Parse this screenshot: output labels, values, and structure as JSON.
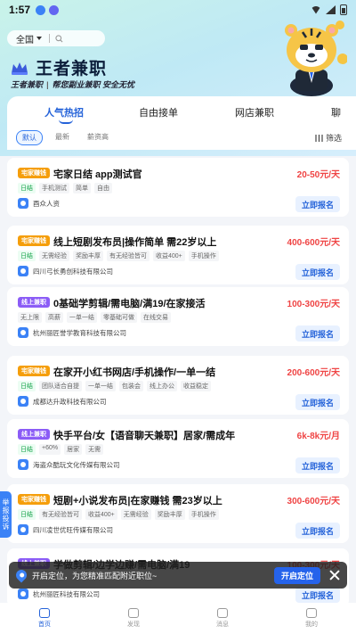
{
  "status_bar": {
    "time": "1:57"
  },
  "search": {
    "city": "全国"
  },
  "brand": {
    "title": "王者兼职",
    "subtitle_left": "王者兼职",
    "subtitle_right": "帮您副业兼职 安全无忧"
  },
  "tabs": [
    {
      "label": "人气热招",
      "active": true
    },
    {
      "label": "自由接单",
      "active": false
    },
    {
      "label": "网店兼职",
      "active": false
    },
    {
      "label": "聊",
      "active": false
    }
  ],
  "subfilters": [
    {
      "label": "默认",
      "active": true
    },
    {
      "label": "最新",
      "active": false
    },
    {
      "label": "薪资高",
      "active": false
    }
  ],
  "filter_label": "筛选",
  "jobs": [
    {
      "badge": "宅家赚钱",
      "badge_color": "orange",
      "title": "宅家日结 app测试官",
      "salary": "20-50元/天",
      "tags": [
        {
          "text": "日结",
          "green": true
        },
        {
          "text": "手机测试",
          "green": false
        },
        {
          "text": "简单",
          "green": false
        },
        {
          "text": "自由",
          "green": false
        }
      ],
      "company": "酉众人资",
      "apply": "立即报名"
    },
    {
      "badge": "宅家赚钱",
      "badge_color": "orange",
      "title": "线上短剧发布员|操作简单 需22岁以上",
      "salary": "400-600元/天",
      "tags": [
        {
          "text": "日结",
          "green": true
        },
        {
          "text": "无需经验",
          "green": false
        },
        {
          "text": "奖励丰厚",
          "green": false
        },
        {
          "text": "有无经验皆可",
          "green": false
        },
        {
          "text": "收益400+",
          "green": false
        },
        {
          "text": "手机操作",
          "green": false
        }
      ],
      "company": "四川弓长勇创科技有限公司",
      "apply": "立即报名"
    },
    {
      "badge": "线上兼职",
      "badge_color": "purple",
      "title": "0基础学剪辑/需电脑/满19/在家接活",
      "salary": "100-300元/天",
      "tags": [
        {
          "text": "无上限",
          "green": false
        },
        {
          "text": "高薪",
          "green": false
        },
        {
          "text": "一单一结",
          "green": false
        },
        {
          "text": "零基础可做",
          "green": false
        },
        {
          "text": "在线交易",
          "green": false
        }
      ],
      "company": "杭州丽匠誉学教育科技有限公司",
      "apply": "立即报名"
    },
    {
      "badge": "宅家赚钱",
      "badge_color": "orange",
      "title": "在家开小红书网店/手机操作/一单一结",
      "salary": "200-600元/天",
      "tags": [
        {
          "text": "日结",
          "green": true
        },
        {
          "text": "团队适合自提",
          "green": false
        },
        {
          "text": "一单一结",
          "green": false
        },
        {
          "text": "包装会",
          "green": false
        },
        {
          "text": "线上办公",
          "green": false
        },
        {
          "text": "收益稳定",
          "green": false
        }
      ],
      "company": "成都达升政科技有限公司",
      "apply": "立即报名"
    },
    {
      "badge": "线上兼职",
      "badge_color": "purple",
      "title": "快手平台/女【语音聊天兼职】居家/需成年",
      "salary": "6k-8k元/月",
      "tags": [
        {
          "text": "日结",
          "green": true
        },
        {
          "text": "+60%",
          "green": false
        },
        {
          "text": "居家",
          "green": false
        },
        {
          "text": "无需",
          "green": false
        }
      ],
      "company": "海盗众酷玩文化传媒有限公司",
      "apply": "立即报名"
    },
    {
      "badge": "宅家赚钱",
      "badge_color": "orange",
      "title": "短剧+小说发布员|在家赚钱 需23岁以上",
      "salary": "300-600元/天",
      "tags": [
        {
          "text": "日结",
          "green": true
        },
        {
          "text": "有无经验皆可",
          "green": false
        },
        {
          "text": "收益400+",
          "green": false
        },
        {
          "text": "无需经验",
          "green": false
        },
        {
          "text": "奖励丰厚",
          "green": false
        },
        {
          "text": "手机操作",
          "green": false
        }
      ],
      "company": "四川凌世优旺传媒有限公司",
      "apply": "立即报名"
    },
    {
      "badge": "线上兼职",
      "badge_color": "purple",
      "title": "学做剪辑/边学边赚/需电脑/满19",
      "salary": "100-300元/天",
      "tags": [],
      "company": "杭州丽匠科技有限公司",
      "apply": "立即报名"
    }
  ],
  "report_tab": "举报投诉",
  "location_bar": {
    "text": "开启定位，为您精准匹配附近职位~",
    "button": "开启定位"
  },
  "bottom_nav": [
    {
      "label": "首页",
      "active": true,
      "icon": "home-icon"
    },
    {
      "label": "发现",
      "active": false,
      "icon": "discover-icon"
    },
    {
      "label": "消息",
      "active": false,
      "icon": "message-icon"
    },
    {
      "label": "我的",
      "active": false,
      "icon": "profile-icon"
    }
  ]
}
